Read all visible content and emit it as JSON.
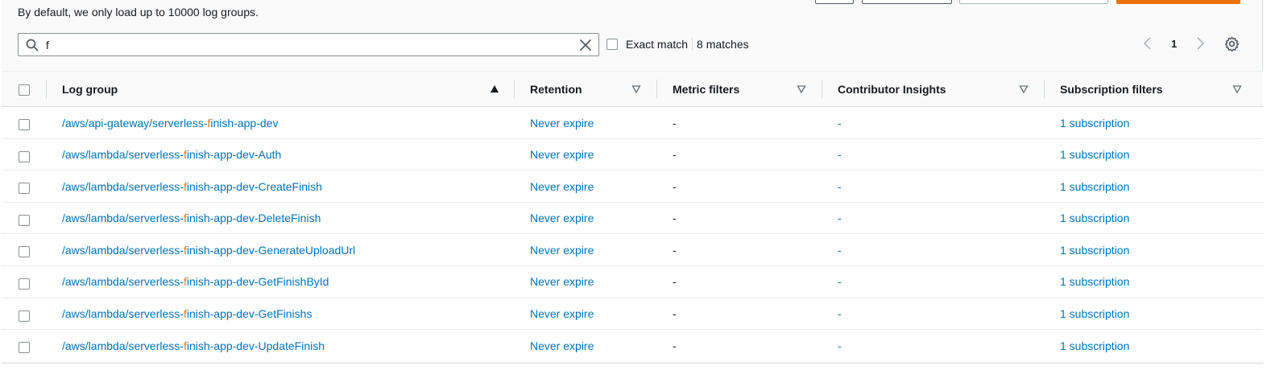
{
  "header": {
    "subtitle": "By default, we only load up to 10000 log groups."
  },
  "search": {
    "value": "f",
    "icon": "search-icon",
    "clear_icon": "close-icon"
  },
  "filter": {
    "exact_match_label": "Exact match",
    "exact_match_checked": false,
    "matches_text": "8 matches"
  },
  "pagination": {
    "current_page": "1"
  },
  "colors": {
    "link": "#0073bb",
    "highlight": "#ec7211",
    "primary_button": "#ec7211"
  },
  "table": {
    "columns": [
      {
        "label": "Log group",
        "sort": "ascending"
      },
      {
        "label": "Retention",
        "sort": "none"
      },
      {
        "label": "Metric filters",
        "sort": "none"
      },
      {
        "label": "Contributor Insights",
        "sort": "none"
      },
      {
        "label": "Subscription filters",
        "sort": "none"
      }
    ],
    "rows": [
      {
        "pre": "/aws/api-gateway/serverless-",
        "hl": "f",
        "post": "inish-app-dev",
        "retention": "Never expire",
        "metric": "-",
        "insights": "-",
        "subscription": "1 subscription"
      },
      {
        "pre": "/aws/lambda/serverless-",
        "hl": "f",
        "post": "inish-app-dev-Auth",
        "retention": "Never expire",
        "metric": "-",
        "insights": "-",
        "subscription": "1 subscription"
      },
      {
        "pre": "/aws/lambda/serverless-",
        "hl": "f",
        "post": "inish-app-dev-CreateFinish",
        "retention": "Never expire",
        "metric": "-",
        "insights": "-",
        "subscription": "1 subscription"
      },
      {
        "pre": "/aws/lambda/serverless-",
        "hl": "f",
        "post": "inish-app-dev-DeleteFinish",
        "retention": "Never expire",
        "metric": "-",
        "insights": "-",
        "subscription": "1 subscription"
      },
      {
        "pre": "/aws/lambda/serverless-",
        "hl": "f",
        "post": "inish-app-dev-GenerateUploadUrl",
        "retention": "Never expire",
        "metric": "-",
        "insights": "-",
        "subscription": "1 subscription"
      },
      {
        "pre": "/aws/lambda/serverless-",
        "hl": "f",
        "post": "inish-app-dev-GetFinishById",
        "retention": "Never expire",
        "metric": "-",
        "insights": "-",
        "subscription": "1 subscription"
      },
      {
        "pre": "/aws/lambda/serverless-",
        "hl": "f",
        "post": "inish-app-dev-GetFinishs",
        "retention": "Never expire",
        "metric": "-",
        "insights": "-",
        "subscription": "1 subscription"
      },
      {
        "pre": "/aws/lambda/serverless-",
        "hl": "f",
        "post": "inish-app-dev-UpdateFinish",
        "retention": "Never expire",
        "metric": "-",
        "insights": "-",
        "subscription": "1 subscription"
      }
    ]
  }
}
